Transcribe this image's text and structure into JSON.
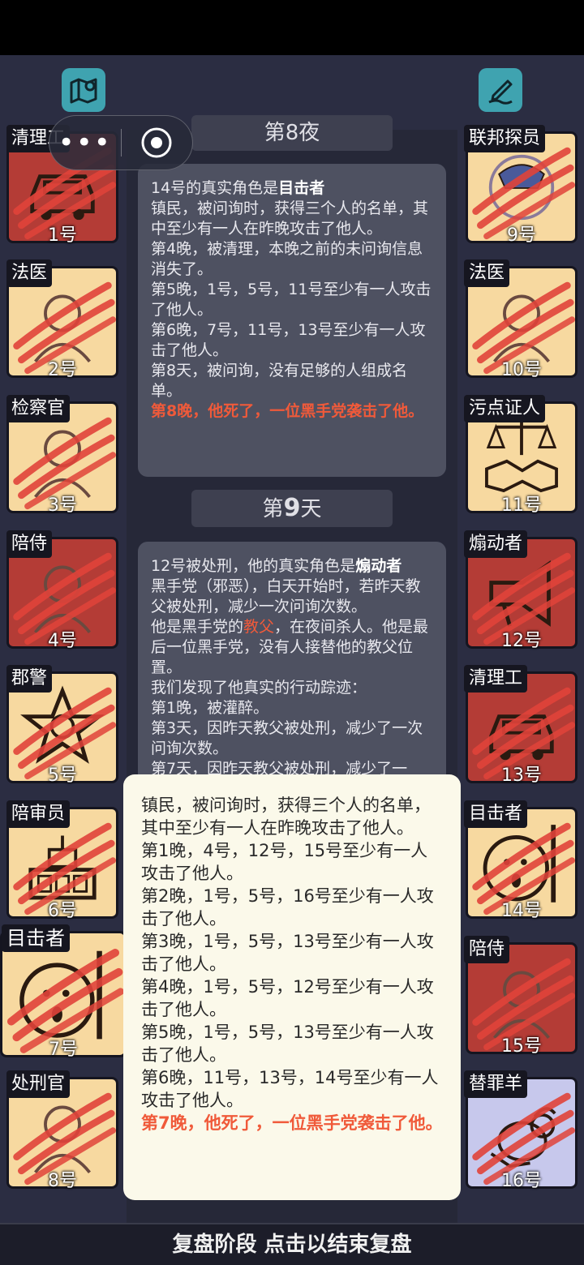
{
  "header": {
    "map_icon": "map-pin-icon",
    "edit_icon": "edit-pen-icon",
    "capsule_more": "•••",
    "capsule_close_icon": "target-circle-icon"
  },
  "players_left": [
    {
      "role": "清理工",
      "number": "1号",
      "icon": "car-icon",
      "dead": true
    },
    {
      "role": "法医",
      "number": "2号",
      "icon": "forensic-portrait-icon",
      "dead": true
    },
    {
      "role": "检察官",
      "number": "3号",
      "icon": "prosecutor-portrait-icon",
      "dead": true
    },
    {
      "role": "陪侍",
      "number": "4号",
      "icon": "escort-portrait-icon",
      "dead": true
    },
    {
      "role": "郡警",
      "number": "5号",
      "icon": "sheriff-star-icon",
      "dead": true
    },
    {
      "role": "陪审员",
      "number": "6号",
      "icon": "jury-bench-icon",
      "dead": true
    },
    {
      "role": "目击者",
      "number": "7号",
      "icon": "witness-face-icon",
      "dead": true
    },
    {
      "role": "处刑官",
      "number": "8号",
      "icon": "executioner-portrait-icon",
      "dead": true
    }
  ],
  "players_right": [
    {
      "role": "联邦探员",
      "number": "9号",
      "icon": "agent-badge-icon",
      "dead": true
    },
    {
      "role": "法医",
      "number": "10号",
      "icon": "forensic-portrait-icon",
      "dead": true
    },
    {
      "role": "污点证人",
      "number": "11号",
      "icon": "scales-handshake-icon",
      "dead": false
    },
    {
      "role": "煽动者",
      "number": "12号",
      "icon": "megaphone-icon",
      "dead": true
    },
    {
      "role": "清理工",
      "number": "13号",
      "icon": "car-icon",
      "dead": true
    },
    {
      "role": "目击者",
      "number": "14号",
      "icon": "witness-face-icon",
      "dead": true
    },
    {
      "role": "陪侍",
      "number": "15号",
      "icon": "escort-portrait-icon",
      "dead": true
    },
    {
      "role": "替罪羊",
      "number": "16号",
      "icon": "goat-icon",
      "dead": true
    }
  ],
  "log": {
    "night8_title": "第8夜",
    "entry1": {
      "intro": "14号的真实角色是",
      "role": "目击者",
      "lines": "镇民，被问询时，获得三个人的名单，其中至少有一人在昨晚攻击了他人。\n第4晚，被清理，本晚之前的未问询信息消失了。\n第5晚，1号，5号，11号至少有一人攻击了他人。\n第6晚，7号，11号，13号至少有一人攻击了他人。\n第8天，被问询，没有足够的人组成名单。",
      "death": "第8晚，他死了，一位黑手党袭击了他。"
    },
    "day9_title_pre": "第",
    "day9_title_num": "9",
    "day9_title_post": "天",
    "entry2": {
      "intro": "12号被处刑，他的真实角色是",
      "role": "煽动者",
      "line1": "黑手党（邪恶），白天开始时，若昨天教父被处刑，减少一次问询次数。",
      "line2_pre": "他是黑手党的",
      "line2_red": "教父",
      "line2_post": "，在夜间杀人。他是最后一位黑手党，没有人接替他的教父位置。",
      "lines": "我们发现了他真实的行动踪迹：\n第1晚，被灌醉。\n第3天，因昨天教父被处刑，减少了一次问询次数。\n第7天，因昨天教父被处刑，减少了一"
    }
  },
  "popup": {
    "text": "镇民，被问询时，获得三个人的名单，其中至少有一人在昨晚攻击了他人。\n第1晚，4号，12号，15号至少有一人攻击了他人。\n第2晚，1号，5号，16号至少有一人攻击了他人。\n第3晚，1号，5号，13号至少有一人攻击了他人。\n第4晚，1号，5号，12号至少有一人攻击了他人。\n第5晚，1号，5号，13号至少有一人攻击了他人。\n第6晚，11号，13号，14号至少有一人攻击了他人。",
    "death": "第7晚，他死了，一位黑手党袭击了他。"
  },
  "footer": {
    "label": "复盘阶段 点击以结束复盘"
  },
  "colors": {
    "background": "#2b2d42",
    "card": "#f7d9a0",
    "card_dead": "#b43c36",
    "slash": "#e0433a",
    "accent_teal": "#3fa3b0",
    "death_text": "#f05a3a"
  }
}
